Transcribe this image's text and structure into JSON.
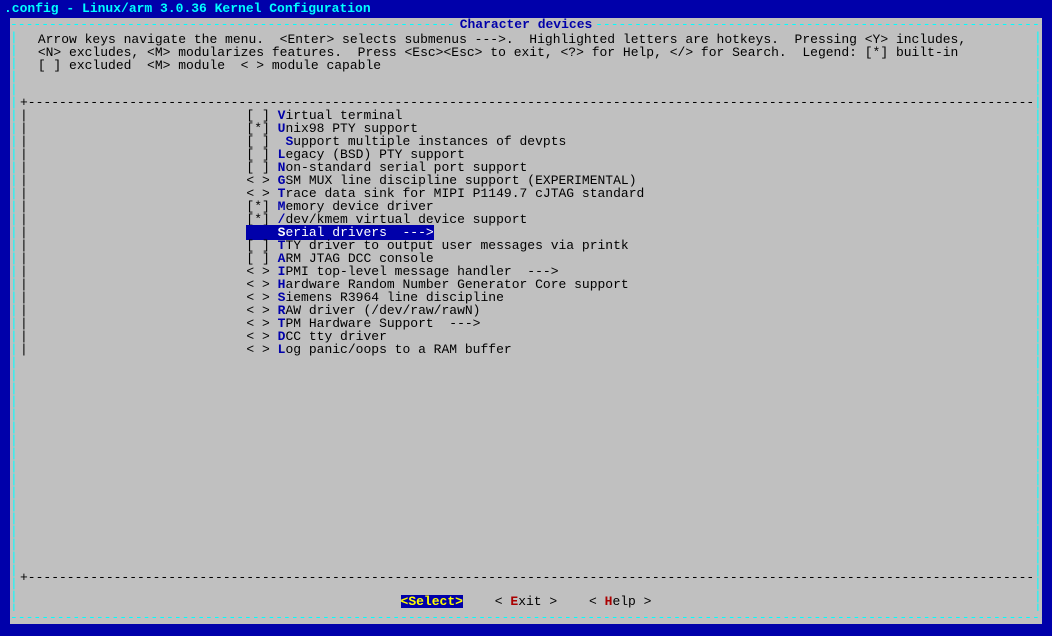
{
  "title": ".config - Linux/arm 3.0.36 Kernel Configuration",
  "section_title": "Character devices",
  "help_lines": [
    " Arrow keys navigate the menu.  <Enter> selects submenus --->.  Highlighted letters are hotkeys.  Pressing <Y> includes,",
    " <N> excludes, <M> modularizes features.  Press <Esc><Esc> to exit, <?> for Help, </> for Search.  Legend: [*] built-in",
    " [ ] excluded  <M> module  < > module capable"
  ],
  "menu": [
    {
      "marker": "[ ]",
      "hot": "V",
      "text": "irtual terminal",
      "selected": false,
      "arrow": ""
    },
    {
      "marker": "[*]",
      "hot": "U",
      "text": "nix98 PTY support",
      "selected": false,
      "arrow": ""
    },
    {
      "marker": "[ ]",
      "hot": " S",
      "text": "upport multiple instances of devpts",
      "selected": false,
      "arrow": "",
      "extra_indent": " "
    },
    {
      "marker": "[ ]",
      "hot": "L",
      "text": "egacy (BSD) PTY support",
      "selected": false,
      "arrow": ""
    },
    {
      "marker": "[ ]",
      "hot": "N",
      "text": "on-standard serial port support",
      "selected": false,
      "arrow": ""
    },
    {
      "marker": "< >",
      "hot": "G",
      "text": "SM MUX line discipline support (EXPERIMENTAL)",
      "selected": false,
      "arrow": ""
    },
    {
      "marker": "< >",
      "hot": "T",
      "text": "race data sink for MIPI P1149.7 cJTAG standard",
      "selected": false,
      "arrow": ""
    },
    {
      "marker": "[*]",
      "hot": "M",
      "text": "emory device driver",
      "selected": false,
      "arrow": ""
    },
    {
      "marker": "[*]",
      "hot": "/",
      "text": "dev/kmem virtual device support",
      "selected": false,
      "arrow": ""
    },
    {
      "marker": "   ",
      "hot": "S",
      "text": "erial drivers  ---",
      "selected": true,
      "arrow": ">"
    },
    {
      "marker": "[ ]",
      "hot": "T",
      "text": "TY driver to output user messages via printk",
      "selected": false,
      "arrow": ""
    },
    {
      "marker": "[ ]",
      "hot": "A",
      "text": "RM JTAG DCC console",
      "selected": false,
      "arrow": ""
    },
    {
      "marker": "< >",
      "hot": "I",
      "text": "PMI top-level message handler  --->",
      "selected": false,
      "arrow": ""
    },
    {
      "marker": "< >",
      "hot": "H",
      "text": "ardware Random Number Generator Core support",
      "selected": false,
      "arrow": ""
    },
    {
      "marker": "< >",
      "hot": "S",
      "text": "iemens R3964 line discipline",
      "selected": false,
      "arrow": ""
    },
    {
      "marker": "< >",
      "hot": "R",
      "text": "AW driver (/dev/raw/rawN)",
      "selected": false,
      "arrow": ""
    },
    {
      "marker": "< >",
      "hot": "T",
      "text": "PM Hardware Support  --->",
      "selected": false,
      "arrow": ""
    },
    {
      "marker": "< >",
      "hot": "D",
      "text": "CC tty driver",
      "selected": false,
      "arrow": ""
    },
    {
      "marker": "< >",
      "hot": "L",
      "text": "og panic/oops to a RAM buffer",
      "selected": false,
      "arrow": ""
    }
  ],
  "buttons": {
    "select": "<Select>",
    "exit_pre": "< ",
    "exit_hot": "E",
    "exit_post": "xit >",
    "help_pre": "< ",
    "help_hot": "H",
    "help_post": "elp >"
  }
}
